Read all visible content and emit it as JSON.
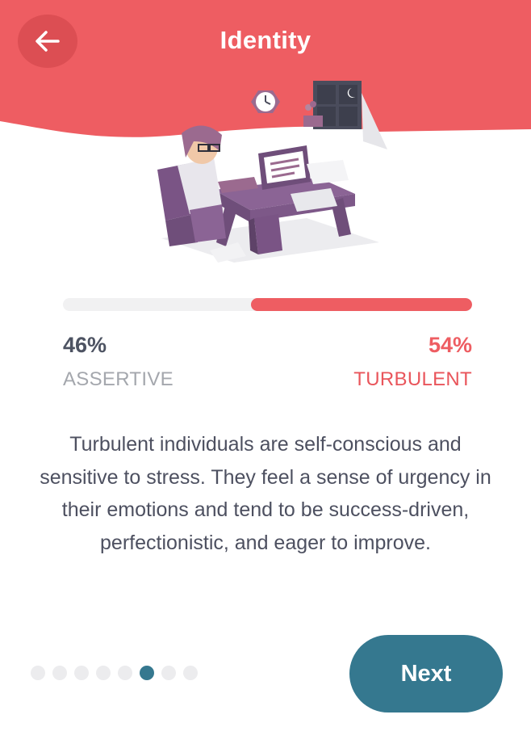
{
  "header": {
    "title": "Identity",
    "back_icon": "arrow-left-icon",
    "color": "#ee5d62"
  },
  "illustration": {
    "icon": "stressed-person-at-desk-illustration"
  },
  "trait": {
    "left_percent": "46%",
    "left_label": "ASSERTIVE",
    "right_percent": "54%",
    "right_label": "TURBULENT",
    "right_fill_fraction": 0.54,
    "accent_color": "#ee5d62"
  },
  "description": "Turbulent individuals are self-conscious and sensitive to stress. They feel a sense of urgency in their emotions and tend to be success-driven, perfectionistic, and eager to improve.",
  "pagination": {
    "total": 8,
    "active_index": 5,
    "active_color": "#35788f"
  },
  "footer": {
    "next_label": "Next",
    "button_color": "#35788f"
  }
}
